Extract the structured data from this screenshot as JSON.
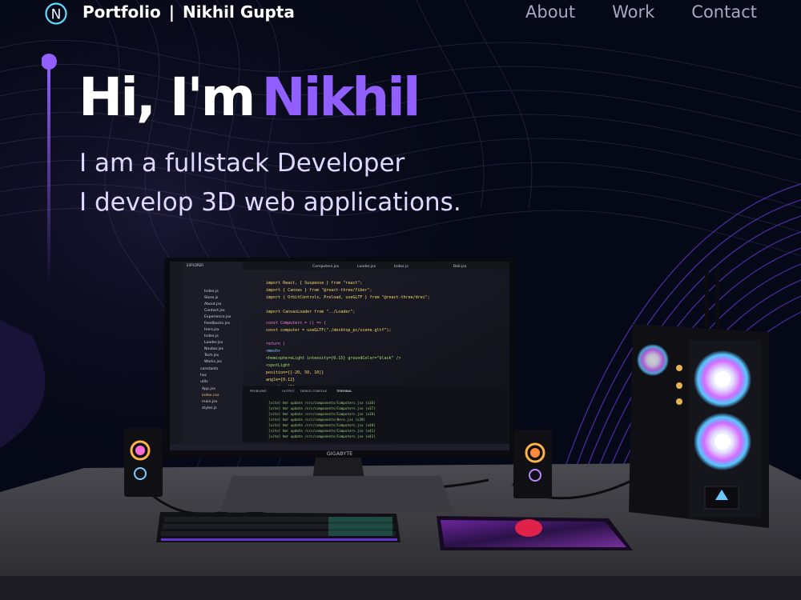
{
  "navbar": {
    "logo_letter": "N",
    "brand_prefix": "Portfolio",
    "brand_separator": "|",
    "brand_name": "Nikhil Gupta",
    "links": [
      {
        "label": "About"
      },
      {
        "label": "Work"
      },
      {
        "label": "Contact"
      }
    ]
  },
  "hero": {
    "greeting": "Hi, I'm",
    "name": "Nikhil",
    "line1": "I am a fullstack Developer",
    "line2": "I develop 3D web applications."
  },
  "scene": {
    "monitor_brand": "GIGABYTE",
    "ide": {
      "tabs": [
        "Computers.jsx",
        "Loader.jsx",
        "Index.js",
        "Ball.jsx"
      ],
      "explorer_title": "EXPLORER",
      "files": [
        "Index.js",
        "Store.js",
        "About.jsx",
        "Contact.jsx",
        "Experience.jsx",
        "Feedbacks.jsx",
        "Hero.jsx",
        "Index.js",
        "Loader.jsx",
        "Navbar.jsx",
        "Tech.jsx",
        "Works.jsx",
        "constants",
        "hoc",
        "utils",
        "App.jsx",
        "index.css",
        "main.jsx",
        "styles.js"
      ],
      "code": [
        "import React, { Suspense } from \"react\";",
        "import { Canvas } from \"@react-three/fiber\";",
        "import { OrbitControls, Preload, useGLTF } from \"@react-three/drei\";",
        "",
        "import CanvasLoader from \"../Loader\";",
        "",
        "const Computers = () => {",
        "  const computer = useGLTF(\"./desktop_pc/scene.gltf\");",
        "",
        "  return (",
        "    <mesh>",
        "      <hemisphereLight intensity={0.15} groundColor=\"black\" />",
        "      <spotLight",
        "        position={[-20, 50, 10]}",
        "        angle={0.12}",
        "        penumbra={1}"
      ],
      "panel_tabs": [
        "PROBLEMS",
        "OUTPUT",
        "DEBUG CONSOLE",
        "TERMINAL"
      ],
      "terminal": [
        "[vite] hmr update /src/components/Computers.jsx (x36)",
        "[vite] hmr update /src/components/Computers.jsx (x37)",
        "[vite] hmr update /src/components/Computers.jsx (x38)",
        "[vite] hmr update /src/components/Hero.jsx (x39)",
        "[vite] hmr update /src/components/Computers.jsx (x40)",
        "[vite] hmr update /src/components/Computers.jsx (x41)",
        "[vite] hmr update /src/components/Computers.jsx (x42)"
      ]
    }
  },
  "colors": {
    "background": "#050816",
    "accent": "#915eff",
    "nav_text": "#aaa6c3",
    "subtitle": "#dfd9ff"
  },
  "icons": [
    "logo-n-icon",
    "hero-line-dot"
  ]
}
